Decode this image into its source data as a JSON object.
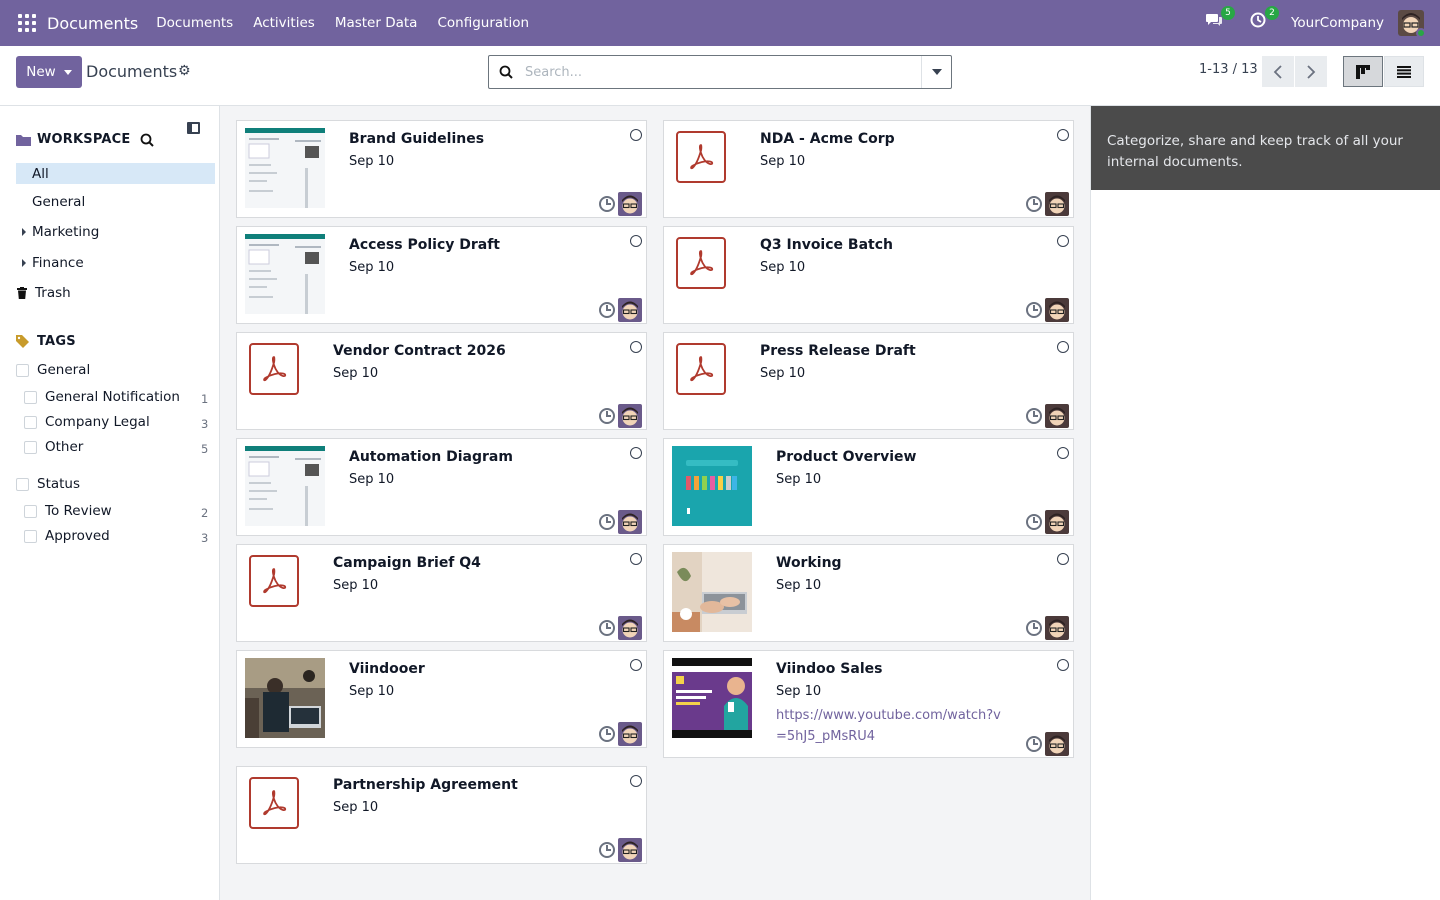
{
  "navbar": {
    "app_name": "Documents",
    "menu": [
      "Documents",
      "Activities",
      "Master Data",
      "Configuration"
    ],
    "messages_count": "5",
    "activities_count": "2",
    "company": "YourCompany",
    "bg_color": "#71639e"
  },
  "control": {
    "new_label": "New",
    "title": "Documents",
    "search_placeholder": "Search...",
    "pager": "1-13 / 13"
  },
  "sidebar": {
    "workspace_header": "WORKSPACE",
    "workspaces": [
      "All",
      "General",
      "Marketing",
      "Finance",
      "Trash"
    ],
    "tags_header": "TAGS",
    "tag_groups": [
      {
        "name": "General",
        "tags": [
          {
            "name": "General Notification",
            "count": "1"
          },
          {
            "name": "Company Legal",
            "count": "3"
          },
          {
            "name": "Other",
            "count": "5"
          }
        ]
      },
      {
        "name": "Status",
        "tags": [
          {
            "name": "To Review",
            "count": "2"
          },
          {
            "name": "Approved",
            "count": "3"
          }
        ]
      }
    ]
  },
  "documents": [
    {
      "title": "Brand Guidelines",
      "date": "Sep 10",
      "thumb": "screenshot"
    },
    {
      "title": "NDA - Acme Corp",
      "date": "Sep 10",
      "thumb": "pdf"
    },
    {
      "title": "Access Policy Draft",
      "date": "Sep 10",
      "thumb": "screenshot"
    },
    {
      "title": "Q3 Invoice Batch",
      "date": "Sep 10",
      "thumb": "pdf"
    },
    {
      "title": "Vendor Contract 2026",
      "date": "Sep 10",
      "thumb": "pdf"
    },
    {
      "title": "Press Release Draft",
      "date": "Sep 10",
      "thumb": "pdf"
    },
    {
      "title": "Automation Diagram",
      "date": "Sep 10",
      "thumb": "screenshot"
    },
    {
      "title": "Product Overview",
      "date": "Sep 10",
      "thumb": "teal"
    },
    {
      "title": "Campaign Brief Q4",
      "date": "Sep 10",
      "thumb": "pdf"
    },
    {
      "title": "Working",
      "date": "Sep 10",
      "thumb": "photo"
    },
    {
      "title": "Viindooer",
      "date": "Sep 10",
      "thumb": "office"
    },
    {
      "title": "Viindoo Sales",
      "date": "Sep 10",
      "thumb": "video",
      "link": "https://www.youtube.com/watch?v=5hJ5_pMsRU4"
    },
    {
      "title": "Partnership Agreement",
      "date": "Sep 10",
      "thumb": "pdf"
    }
  ],
  "help_text": "Categorize, share and keep track of all your internal documents."
}
